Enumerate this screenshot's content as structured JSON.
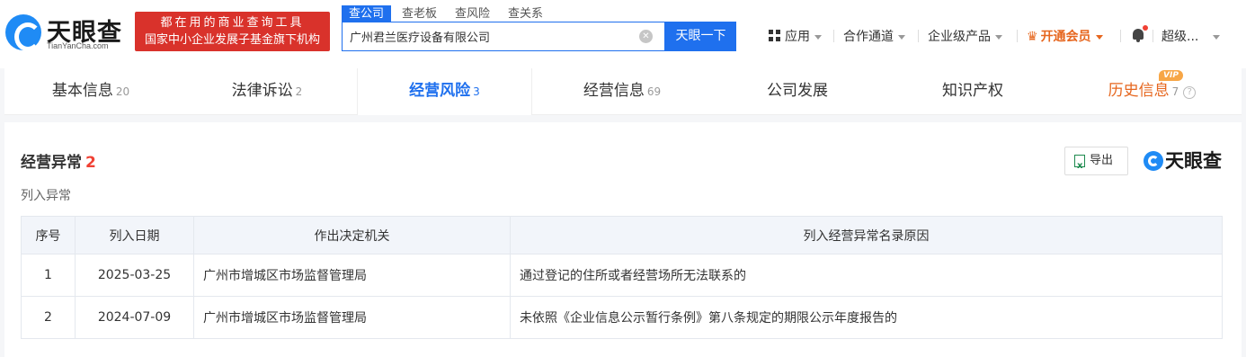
{
  "header": {
    "logo_text": "天眼查",
    "logo_domain": "TianYanCha.com",
    "promo_line1": "都在用的商业查询工具",
    "promo_line2": "国家中小企业发展子基金旗下机构",
    "search_tabs": [
      "查公司",
      "查老板",
      "查风险",
      "查关系"
    ],
    "search_value": "广州君兰医疗设备有限公司",
    "search_button": "天眼一下",
    "nav": {
      "apps": "应用",
      "channels": "合作通道",
      "enterprise": "企业级产品",
      "vip": "开通会员",
      "user": "超级..."
    }
  },
  "page_tabs": [
    {
      "label": "基本信息",
      "count": "20"
    },
    {
      "label": "法律诉讼",
      "count": "2"
    },
    {
      "label": "经营风险",
      "count": "3"
    },
    {
      "label": "经营信息",
      "count": "69"
    },
    {
      "label": "公司发展",
      "count": ""
    },
    {
      "label": "知识产权",
      "count": ""
    },
    {
      "label": "历史信息",
      "count": "7",
      "badge": "VIP"
    }
  ],
  "section": {
    "title": "经营异常",
    "count": "2",
    "export_label": "导出",
    "watermark": "天眼查",
    "subtitle": "列入异常"
  },
  "table": {
    "columns": [
      "序号",
      "列入日期",
      "作出决定机关",
      "列入经营异常名录原因"
    ],
    "rows": [
      {
        "index": "1",
        "date": "2025-03-25",
        "authority": "广州市增城区市场监督管理局",
        "reason": "通过登记的住所或者经营场所无法联系的"
      },
      {
        "index": "2",
        "date": "2024-07-09",
        "authority": "广州市增城区市场监督管理局",
        "reason": "未依照《企业信息公示暂行条例》第八条规定的期限公示年度报告的"
      }
    ]
  },
  "colors": {
    "brand_blue": "#1f70ee",
    "promo_red": "#d9322b",
    "vip_orange": "#e6661e",
    "count_red": "#f04134"
  }
}
